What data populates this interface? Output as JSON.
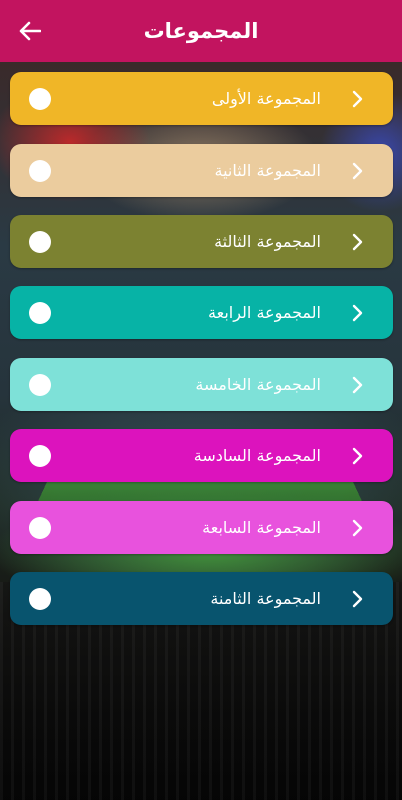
{
  "header": {
    "title": "المجموعات",
    "back_icon": "arrow-left-icon"
  },
  "groups": [
    {
      "label": "المجموعة الأولى",
      "color": "#f0b627"
    },
    {
      "label": "المجموعة الثانية",
      "color": "#ebcc9e"
    },
    {
      "label": "المجموعة الثالثة",
      "color": "#7c8231"
    },
    {
      "label": "المجموعة الرابعة",
      "color": "#07b3a6"
    },
    {
      "label": "المجموعة الخامسة",
      "color": "#7ee1d8"
    },
    {
      "label": "المجموعة السادسة",
      "color": "#dc13bd"
    },
    {
      "label": "المجموعة السابعة",
      "color": "#e852dd"
    },
    {
      "label": "المجموعة الثامنة",
      "color": "#08546e"
    }
  ],
  "colors": {
    "appbar": "#c2145f"
  }
}
